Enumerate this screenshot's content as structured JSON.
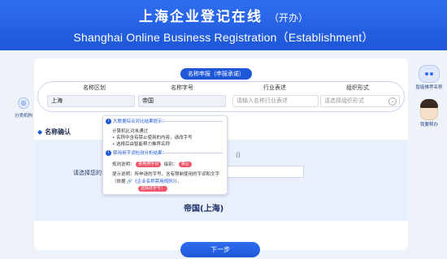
{
  "header": {
    "title_cn": "上海企业登记在线",
    "title_cn_suffix": "（开办）",
    "title_en": "Shanghai Online Business Registration（Establishment）"
  },
  "form": {
    "section_pill": "名称申报（申报承诺）",
    "labels": {
      "district": "名称区划",
      "trade_name": "名称字号",
      "industry": "行业表述",
      "org_form": "组织形式"
    },
    "values": {
      "district": "上海",
      "trade_name": "帝国",
      "industry_placeholder": "请输入名称行业表述",
      "org_form_placeholder": "请选择组织形式"
    }
  },
  "sidebar_left": {
    "label": "分类机构"
  },
  "sidebar_right": {
    "assistant_label": "智能推荐名称",
    "helper_label": "我要帮办"
  },
  "tooltip": {
    "head1": "大数据综合对比结果提示：",
    "l1": "计算机比对未通过",
    "l2": "• 名称中含有禁止使用的内容，请改字号",
    "l3": "• 选择后由智能帮力推荐名称",
    "head2": "禁用用字词检测分析结果：",
    "rule_label": "规则说明：",
    "tag1": "禁用用字词",
    "count_label": "级别：",
    "tag2": "禁止",
    "hint_prefix": "提示说明：所申请的字号，含有限制使用的字词和文字",
    "hint_mid": "（依据",
    "hint_link": "《企业名称禁用规则》",
    "hint_suffix": "）。",
    "tag3": "选择改字号！"
  },
  "confirm": {
    "section_title": "名称确认",
    "choose_label": "请选择您的企",
    "paren_text": "（）",
    "result_name": "帝国(上海)"
  },
  "buttons": {
    "next": "下一步"
  }
}
